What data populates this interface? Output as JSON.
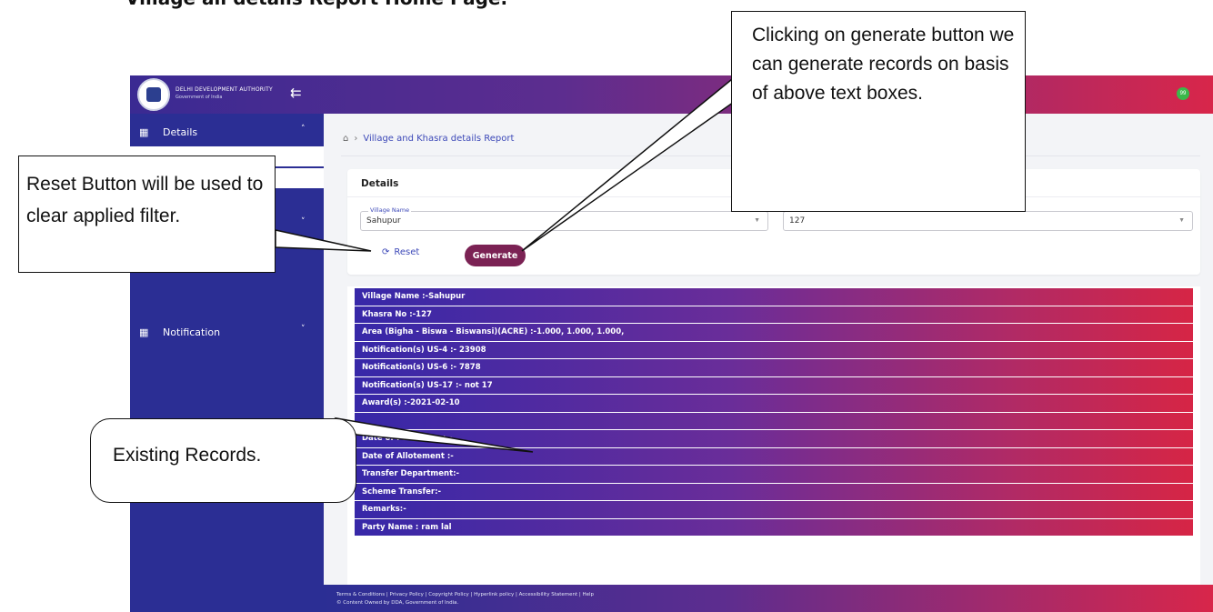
{
  "doc_heading": "Village all details Report Home Page.",
  "app": {
    "org_name": "DELHI DEVELOPMENT AUTHORITY",
    "org_sub": "Government of India",
    "notification_count": "99",
    "accent": "#2b2e94"
  },
  "sidebar": {
    "items": [
      {
        "label": "Details",
        "icon": "grid-icon",
        "chevron": "˄"
      },
      {
        "label": "Notification",
        "icon": "grid-icon",
        "chevron": "˅"
      }
    ]
  },
  "breadcrumb": {
    "current": "Village and Khasra details Report"
  },
  "details_card": {
    "title": "Details",
    "village_legend": "Village Name",
    "village_value": "Sahupur",
    "khasra_value": "127",
    "reset_label": "Reset",
    "generate_label": "Generate"
  },
  "records": [
    "Village Name :-Sahupur",
    "Khasra No :-127",
    "Area (Bigha - Biswa - Biswansi)(ACRE) :-1.000, 1.000, 1.000,",
    "Notification(s) US-4 :- 23908",
    "Notification(s) US-6 :- 7878",
    "Notification(s) US-17 :- not 17",
    "Award(s) :-2021-02-10",
    "",
    "Date of Possesion :--",
    "Date of Allotement :-",
    "Transfer Department:-",
    "Scheme Transfer:-",
    "Remarks:-",
    "Party Name : ram lal"
  ],
  "footer": {
    "links": "Terms & Conditions | Privacy Policy | Copyright Policy | Hyperlink policy | Accessibility Statement | Help",
    "copyright": "© Content Owned by DDA, Government of India."
  },
  "callouts": {
    "reset": "Reset Button will be used to clear applied filter.",
    "generate": "Clicking on generate button we can generate records on basis of above text boxes.",
    "existing": "Existing Records."
  }
}
